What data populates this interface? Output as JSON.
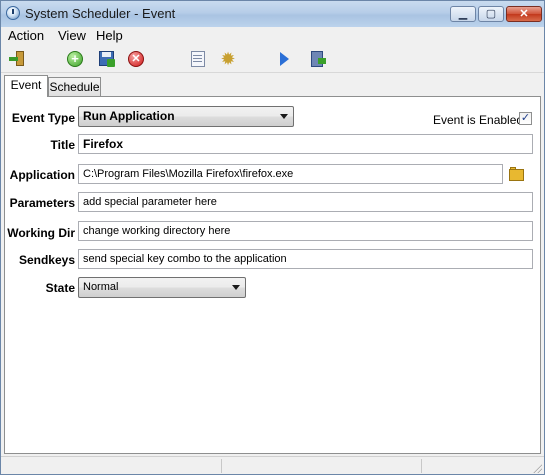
{
  "window": {
    "title": "System Scheduler - Event"
  },
  "title_buttons": {
    "minimize": "▁",
    "maximize": "▢",
    "close": "✕"
  },
  "menu": [
    "Action",
    "View",
    "Help"
  ],
  "toolbar": {
    "icons": [
      "exit-icon",
      "add-icon",
      "save-icon",
      "delete-icon",
      "list-icon",
      "settings-icon",
      "play-icon",
      "run-icon"
    ],
    "add_glyph": "+",
    "delete_glyph": "✕",
    "gear_glyph": "✹"
  },
  "tabs": [
    {
      "label": "Event",
      "active": true
    },
    {
      "label": "Schedule",
      "active": false
    }
  ],
  "form": {
    "event_type": {
      "label": "Event Type",
      "value": "Run Application"
    },
    "enabled": {
      "label": "Event is Enabled",
      "checked": true,
      "glyph": "✓"
    },
    "title": {
      "label": "Title",
      "value": "Firefox"
    },
    "application": {
      "label": "Application",
      "value": "C:\\Program Files\\Mozilla Firefox\\firefox.exe"
    },
    "parameters": {
      "label": "Parameters",
      "value": "add special parameter here"
    },
    "working_dir": {
      "label": "Working Dir",
      "value": "change working directory here"
    },
    "sendkeys": {
      "label": "Sendkeys",
      "value": "send special key combo to the application"
    },
    "state": {
      "label": "State",
      "value": "Normal"
    }
  },
  "colors": {
    "title_bar": "#b6cde8",
    "close_button": "#c2381c",
    "accent": "#3d6db5"
  }
}
